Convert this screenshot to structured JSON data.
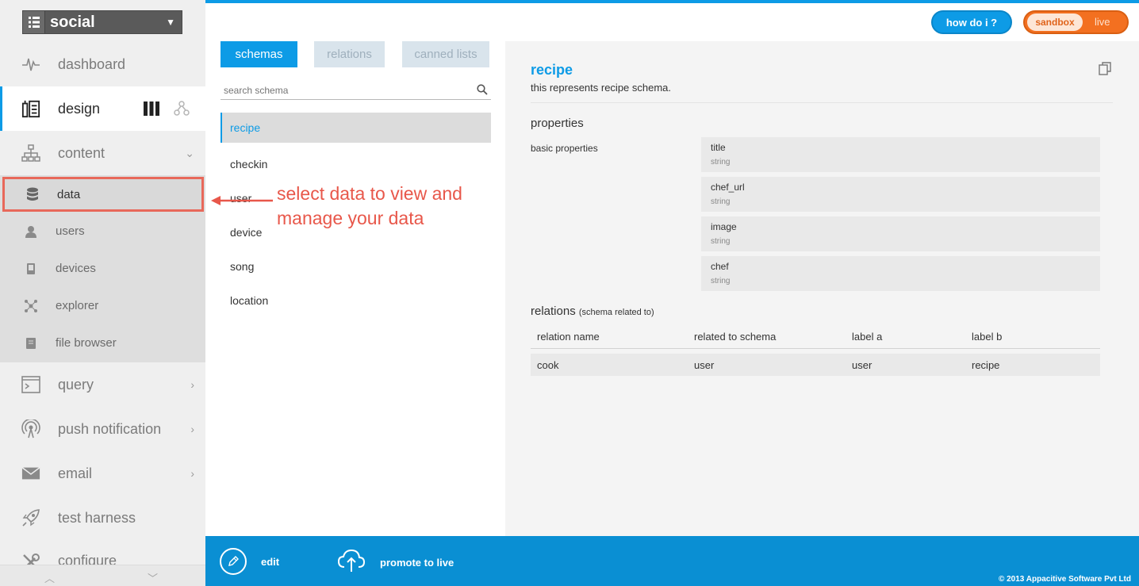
{
  "app": {
    "name": "social"
  },
  "sidebar": {
    "items": [
      {
        "label": "dashboard"
      },
      {
        "label": "design"
      },
      {
        "label": "content"
      },
      {
        "label": "query"
      },
      {
        "label": "push notification"
      },
      {
        "label": "email"
      },
      {
        "label": "test harness"
      },
      {
        "label": "configure"
      }
    ],
    "sub_items": [
      {
        "label": "data"
      },
      {
        "label": "users"
      },
      {
        "label": "devices"
      },
      {
        "label": "explorer"
      },
      {
        "label": "file browser"
      }
    ]
  },
  "tabs": [
    "schemas",
    "relations",
    "canned lists"
  ],
  "search": {
    "placeholder": "search schema"
  },
  "schemas": [
    "recipe",
    "checkin",
    "user",
    "device",
    "song",
    "location"
  ],
  "callout": {
    "text": "select data to view and manage your data"
  },
  "detail": {
    "title": "recipe",
    "description": "this represents recipe schema.",
    "properties_heading": "properties",
    "basic_label": "basic properties",
    "properties": [
      {
        "name": "title",
        "type": "string"
      },
      {
        "name": "chef_url",
        "type": "string"
      },
      {
        "name": "image",
        "type": "string"
      },
      {
        "name": "chef",
        "type": "string"
      }
    ],
    "relations_heading": "relations",
    "relations_sub": "(schema related to)",
    "relations_columns": [
      "relation name",
      "related to schema",
      "label a",
      "label b"
    ],
    "relations_rows": [
      [
        "cook",
        "user",
        "user",
        "recipe"
      ]
    ]
  },
  "header": {
    "howdoi": "how do i ?",
    "env_sandbox": "sandbox",
    "env_live": "live"
  },
  "footer": {
    "edit": "edit",
    "promote": "promote to live",
    "copyright": "© 2013 Appacitive Software Pvt Ltd"
  },
  "colors": {
    "accent": "#0d9be6",
    "footer": "#0a8fd3",
    "callout": "#e8574a",
    "env": "#f37020"
  }
}
